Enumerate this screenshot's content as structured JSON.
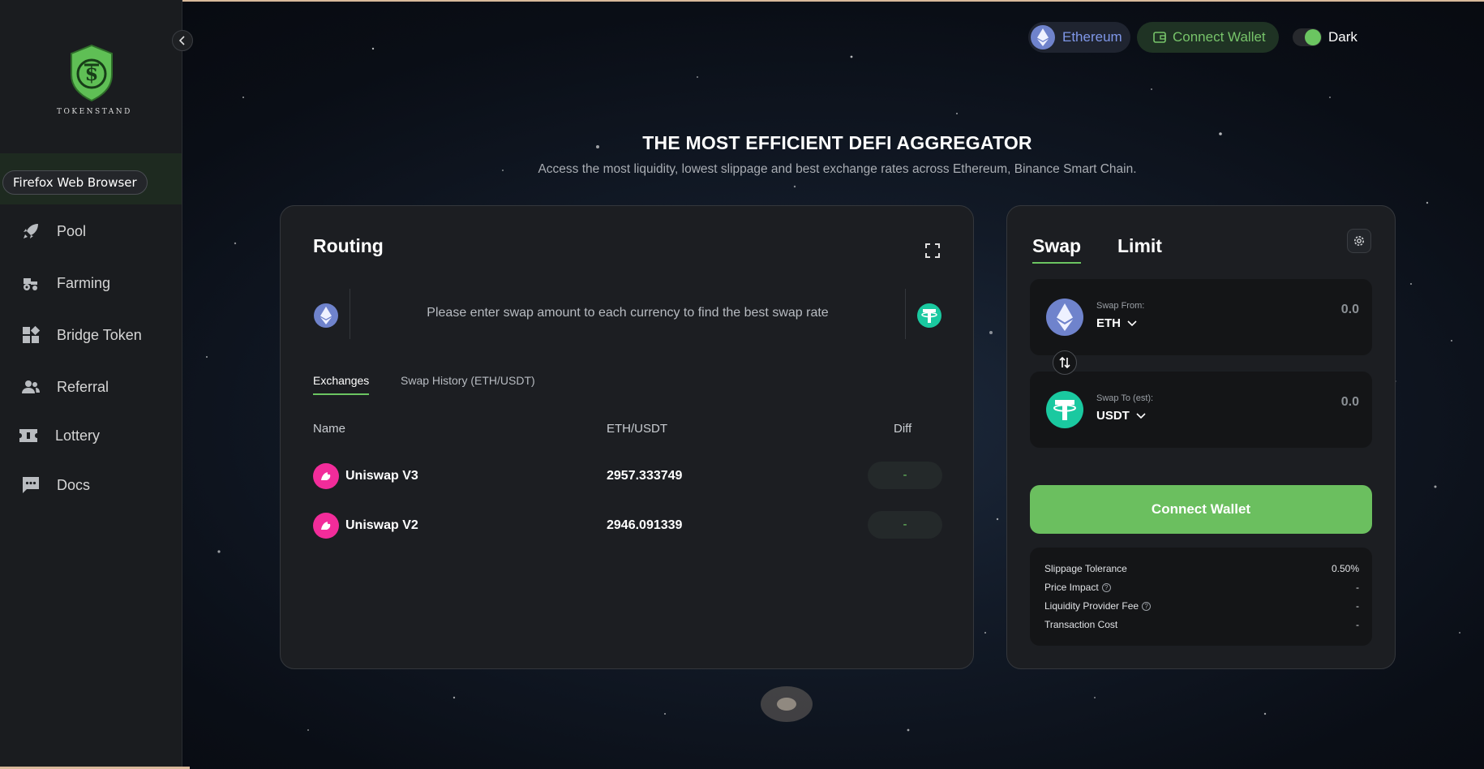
{
  "brand": {
    "name": "TOKENSTAND"
  },
  "tooltip": "Firefox Web Browser",
  "sidebar": {
    "items": [
      {
        "label": "Pool",
        "icon": "rocket-icon"
      },
      {
        "label": "Farming",
        "icon": "tractor-icon"
      },
      {
        "label": "Bridge Token",
        "icon": "apps-icon"
      },
      {
        "label": "Referral",
        "icon": "users-icon"
      },
      {
        "label": "Lottery",
        "icon": "ticket-icon"
      },
      {
        "label": "Docs",
        "icon": "chat-icon"
      }
    ]
  },
  "header": {
    "network": "Ethereum",
    "connect_wallet": "Connect Wallet",
    "theme_label": "Dark"
  },
  "hero": {
    "title": "THE MOST EFFICIENT DEFI AGGREGATOR",
    "subtitle": "Access the most liquidity, lowest slippage and best exchange rates across Ethereum, Binance Smart Chain."
  },
  "routing": {
    "title": "Routing",
    "message": "Please enter swap amount to each currency to find the best swap rate",
    "tabs": {
      "exchanges": "Exchanges",
      "history": "Swap History (ETH/USDT)"
    },
    "columns": {
      "name": "Name",
      "pair": "ETH/USDT",
      "diff": "Diff"
    },
    "rows": [
      {
        "name": "Uniswap V3",
        "price": "2957.333749",
        "diff": "-"
      },
      {
        "name": "Uniswap V2",
        "price": "2946.091339",
        "diff": "-"
      }
    ]
  },
  "swap": {
    "tabs": {
      "swap": "Swap",
      "limit": "Limit"
    },
    "from": {
      "label": "Swap From:",
      "token": "ETH",
      "amount": "0.0"
    },
    "to": {
      "label": "Swap To (est):",
      "token": "USDT",
      "amount": "0.0"
    },
    "connect_button": "Connect Wallet",
    "details": [
      {
        "label": "Slippage Tolerance",
        "value": "0.50%",
        "help": false
      },
      {
        "label": "Price Impact",
        "value": "-",
        "help": true
      },
      {
        "label": "Liquidity Provider Fee",
        "value": "-",
        "help": true
      },
      {
        "label": "Transaction Cost",
        "value": "-",
        "help": false
      }
    ]
  },
  "colors": {
    "accent": "#6bc561",
    "eth": "#7f97e8",
    "usdt": "#1ac9a0",
    "uniswap": "#f22c9a",
    "card": "#1c1e22"
  }
}
